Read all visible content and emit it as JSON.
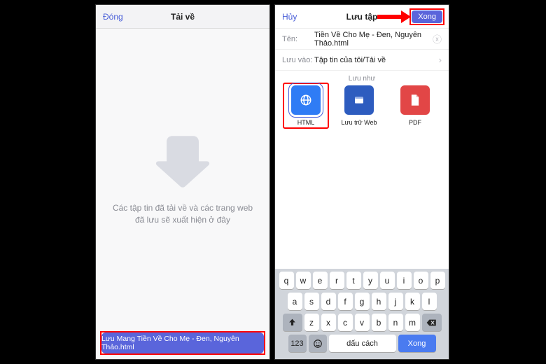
{
  "left": {
    "close": "Đóng",
    "title": "Tải về",
    "empty_text_1": "Các tập tin đã tải về và các trang web",
    "empty_text_2": "đã lưu sẽ xuất hiện ở đây",
    "download_bar": "Lưu Mang Tiền Về Cho Mẹ - Đen, Nguyên Thảo.html"
  },
  "right": {
    "cancel": "Hủy",
    "title": "Lưu tập",
    "done": "Xong",
    "name_label": "Tên:",
    "name_value": "Tiền Về Cho Mẹ - Đen, Nguyên Thảo.html",
    "saveto_label": "Lưu vào:",
    "saveto_value": "Tập tin của tôi/Tải về",
    "saveas_label": "Lưu như",
    "fmt_html": "HTML",
    "fmt_web": "Lưu trữ Web",
    "fmt_pdf": "PDF"
  },
  "kb": {
    "r1": [
      "q",
      "w",
      "e",
      "r",
      "t",
      "y",
      "u",
      "i",
      "o",
      "p"
    ],
    "r2": [
      "a",
      "s",
      "d",
      "f",
      "g",
      "h",
      "j",
      "k",
      "l"
    ],
    "r3": [
      "z",
      "x",
      "c",
      "v",
      "b",
      "n",
      "m"
    ],
    "n123": "123",
    "space": "dấu cách",
    "return": "Xong"
  }
}
